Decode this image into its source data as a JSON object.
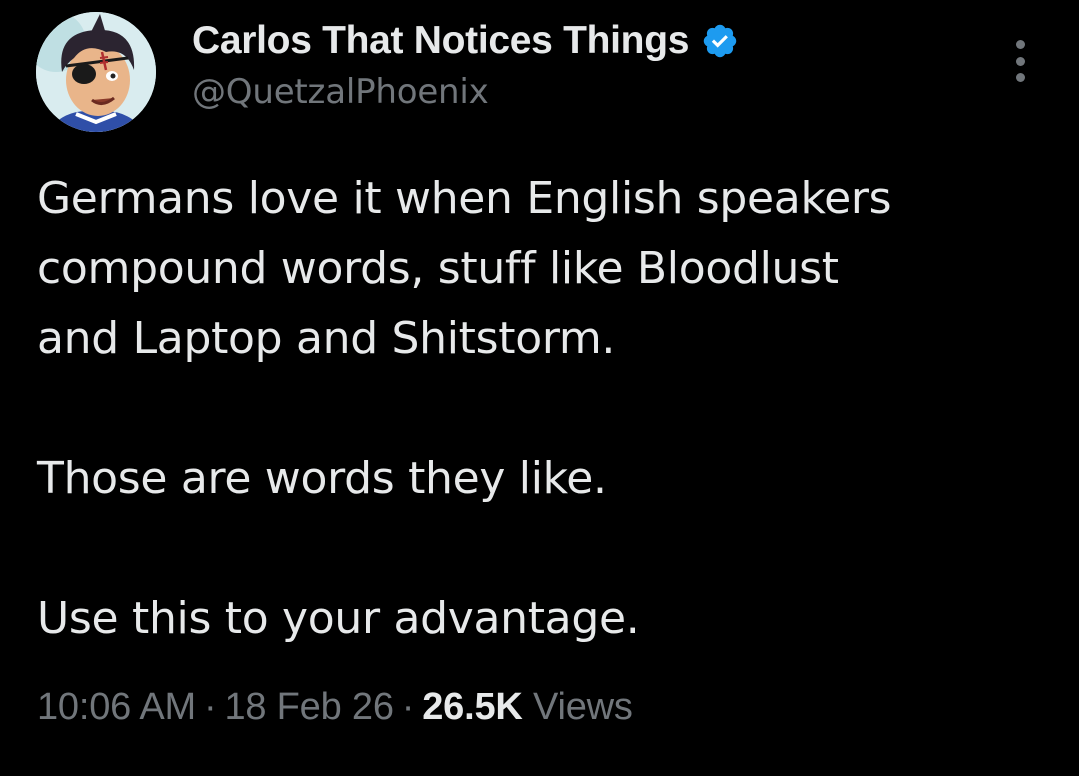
{
  "author": {
    "display_name": "Carlos That Notices Things",
    "handle": "@QuetzalPhoenix",
    "verified": true,
    "verified_color": "#1d9bf0"
  },
  "tweet": {
    "paragraphs": [
      "Germans love it when English speakers compound words, stuff like Bloodlust and Laptop and Shitstorm.",
      "Those are words they like.",
      "Use this to your advantage."
    ],
    "lines": [
      "Germans love it when English speakers",
      "compound words, stuff like Bloodlust",
      "and Laptop and Shitstorm."
    ],
    "line2": "Those are words they like.",
    "line3": "Use this to your advantage."
  },
  "meta": {
    "time": "10:06 AM",
    "date": "18 Feb 26",
    "separator": "·",
    "views_count": "26.5K",
    "views_label": "Views"
  },
  "colors": {
    "background": "#000000",
    "text_primary": "#e7e9ea",
    "text_secondary": "#71767b"
  },
  "icons": {
    "more": "more-vertical-icon",
    "verified": "verified-badge-icon"
  }
}
